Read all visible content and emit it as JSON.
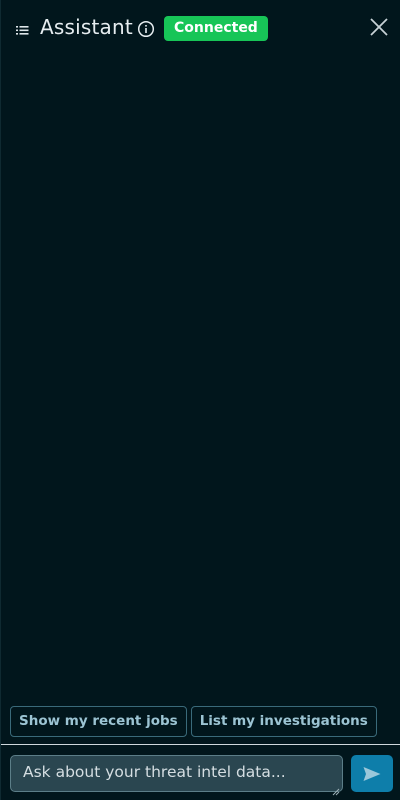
{
  "header": {
    "title": "Assistant",
    "status": "Connected",
    "status_color": "#17c557",
    "menu_icon": "list-menu-icon",
    "info_icon": "info-circle-icon",
    "close_icon": "close-icon"
  },
  "suggestions": [
    {
      "label": "Show my recent jobs"
    },
    {
      "label": "List my investigations"
    }
  ],
  "composer": {
    "placeholder": "Ask about your threat intel data...",
    "value": "",
    "send_icon": "send-arrow-icon",
    "accent": "#0e7eaa"
  }
}
